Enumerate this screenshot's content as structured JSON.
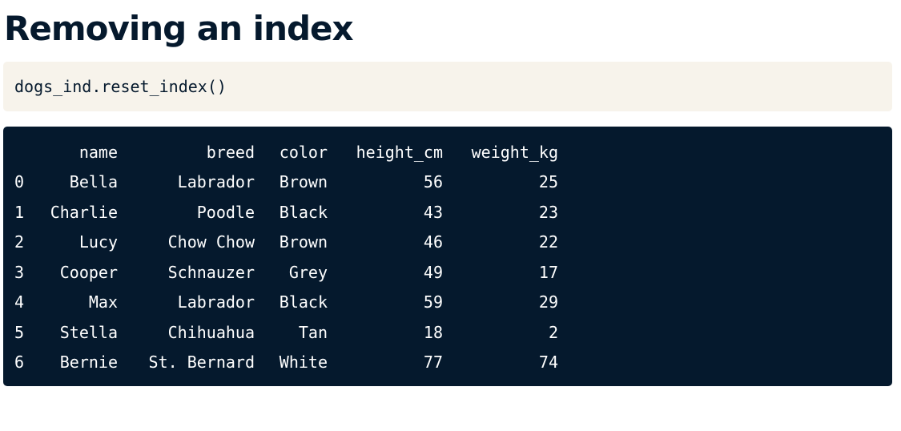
{
  "title": "Removing an index",
  "code": "dogs_ind.reset_index()",
  "table": {
    "columns": [
      "",
      "name",
      "breed",
      "color",
      "height_cm",
      "weight_kg"
    ],
    "rows": [
      [
        "0",
        "Bella",
        "Labrador",
        "Brown",
        "56",
        "25"
      ],
      [
        "1",
        "Charlie",
        "Poodle",
        "Black",
        "43",
        "23"
      ],
      [
        "2",
        "Lucy",
        "Chow Chow",
        "Brown",
        "46",
        "22"
      ],
      [
        "3",
        "Cooper",
        "Schnauzer",
        "Grey",
        "49",
        "17"
      ],
      [
        "4",
        "Max",
        "Labrador",
        "Black",
        "59",
        "29"
      ],
      [
        "5",
        "Stella",
        "Chihuahua",
        "Tan",
        "18",
        "2"
      ],
      [
        "6",
        "Bernie",
        "St. Bernard",
        "White",
        "77",
        "74"
      ]
    ]
  },
  "colors": {
    "title_text": "#05192d",
    "code_background": "#f7f3eb",
    "output_background": "#05192d",
    "output_text": "#ffffff"
  }
}
